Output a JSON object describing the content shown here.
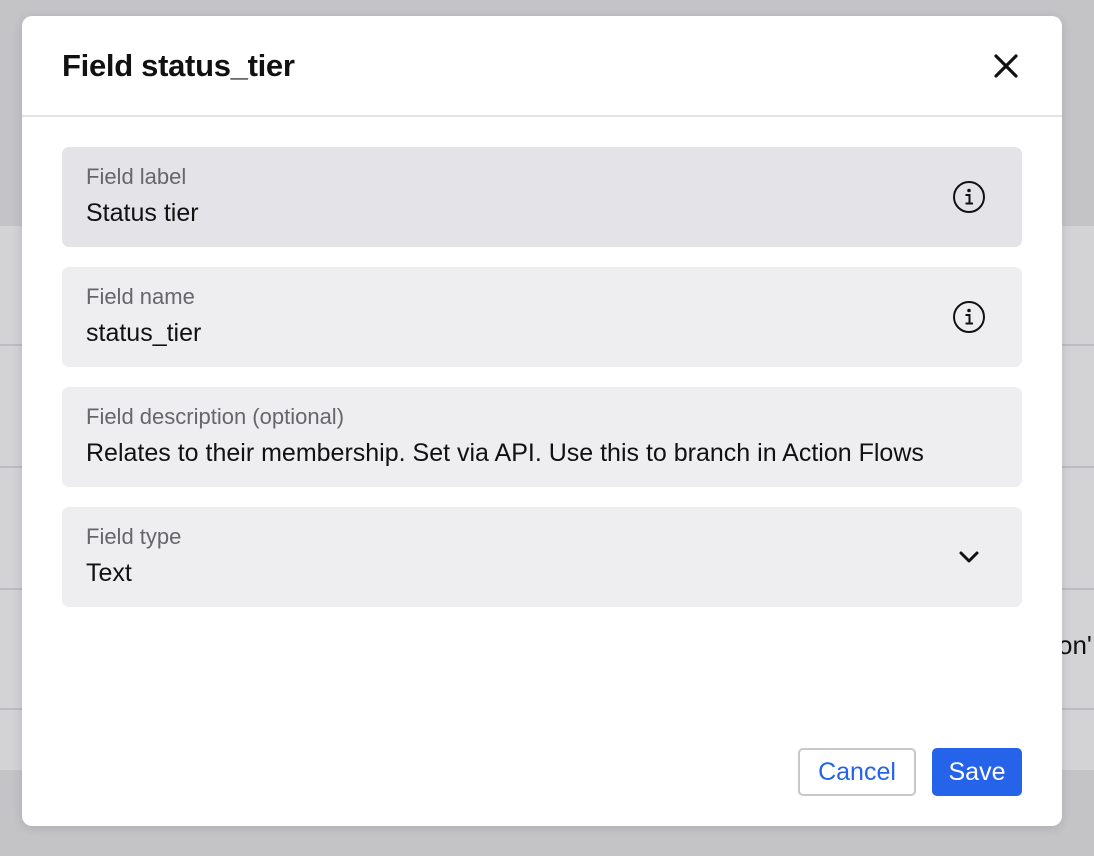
{
  "modal": {
    "title": "Field status_tier",
    "close_icon": "close-icon"
  },
  "fields": [
    {
      "label": "Field label",
      "value": "Status tier",
      "icon": "info-icon"
    },
    {
      "label": "Field name",
      "value": "status_tier",
      "icon": "info-icon"
    },
    {
      "label": "Field description (optional)",
      "value": "Relates to their membership. Set via API. Use this to branch in Action Flows"
    },
    {
      "label": "Field type",
      "value": "Text",
      "icon": "chevron-down-icon"
    }
  ],
  "footer": {
    "cancel_label": "Cancel",
    "save_label": "Save"
  },
  "background": {
    "snippet": "on'"
  },
  "colors": {
    "accent": "#2563eb",
    "field_bg": "#eeeef0",
    "overlay": "#c4c4c7"
  }
}
